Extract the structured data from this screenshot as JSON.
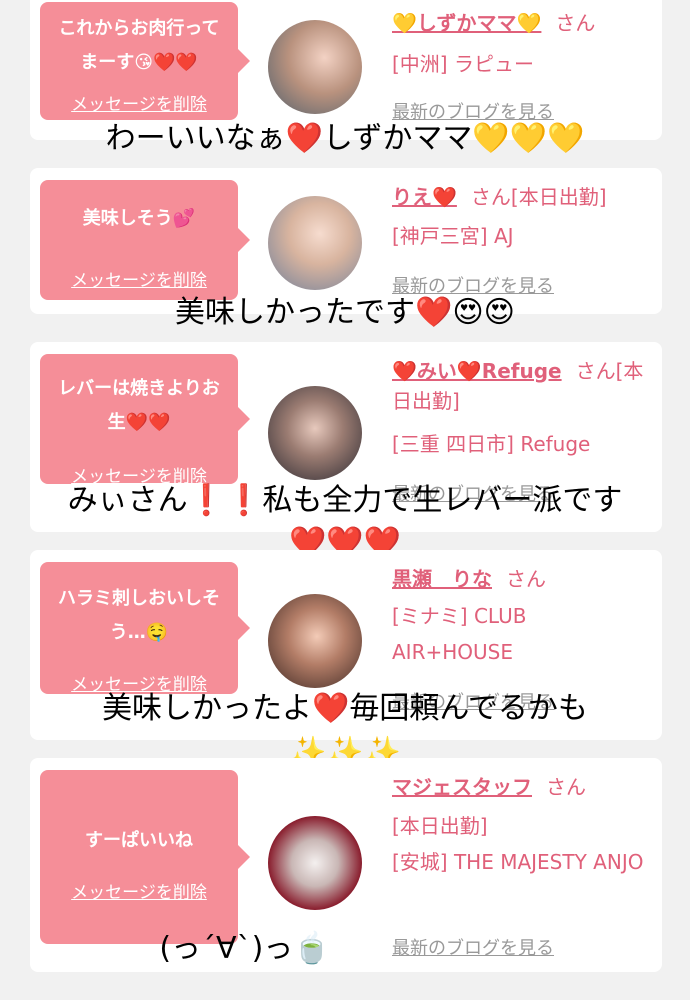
{
  "cards": [
    {
      "bubble": "これからお肉行ってまーす😘❤️❤️",
      "delete": "メッセージを削除",
      "name": "💛しずかママ💛",
      "san": "さん",
      "status": "",
      "location": "[中洲] ラピュー",
      "blog": "最新のブログを見る",
      "comment": "わーいいなぁ❤️しずかママ💛💛💛"
    },
    {
      "bubble": "美味しそう💕",
      "delete": "メッセージを削除",
      "name": "りえ❤️",
      "san": "さん",
      "status": "[本日出勤]",
      "location": "[神戸三宮] AJ",
      "blog": "最新のブログを見る",
      "comment": "美味しかったです❤️😍😍"
    },
    {
      "bubble": "レバーは焼きよりお生❤️❤️",
      "delete": "メッセージを削除",
      "name": "❤️みい❤️Refuge",
      "san": "さん",
      "status": "[本日出勤]",
      "location": "[三重 四日市] Refuge",
      "blog": "最新のブログを見る",
      "comment": "みぃさん❗❗私も全力で生レバー派です",
      "comment2": "❤️❤️❤️"
    },
    {
      "bubble": "ハラミ刺しおいしそう…🤤",
      "delete": "メッセージを削除",
      "name": "黒瀬　りな",
      "san": "さん",
      "status": "",
      "location": "[ミナミ] CLUB AIR+HOUSE",
      "blog": "最新のブログを見る",
      "comment": "美味しかったよ❤️毎回頼んでるかも",
      "comment2": "✨✨✨"
    },
    {
      "bubble": "すーぱいいね",
      "delete": "メッセージを削除",
      "name": "マジェスタッフ",
      "san": "さん",
      "status": "[本日出勤]",
      "location": "[安城] THE MAJESTY ANJO",
      "blog": "最新のブログを見る",
      "comment": "(っ´∀`)っ🍵"
    }
  ],
  "colors": {
    "accent": "#f58e98",
    "link": "#e0607a",
    "background": "#f1f1f1"
  }
}
